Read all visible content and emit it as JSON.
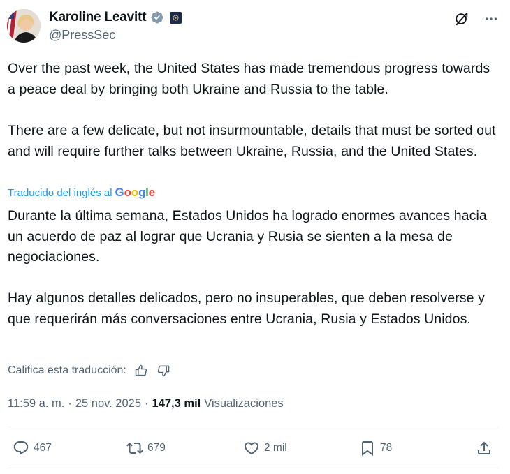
{
  "user": {
    "display_name": "Karoline Leavitt",
    "handle": "@PressSec"
  },
  "tweet": {
    "paragraph_1": "Over the past week, the United States has made tremendous progress towards a peace deal by bringing both Ukraine and Russia to the table.",
    "paragraph_2": "There are a few delicate, but not insurmountable, details that must be sorted out and will require further talks between Ukraine, Russia, and the United States.",
    "translated_label": "Traducido del inglés al",
    "translator": "Google",
    "translation_1": "Durante la última semana, Estados Unidos ha logrado enormes avances hacia un acuerdo de paz al lograr que Ucrania y Rusia se sienten a la mesa de negociaciones.",
    "translation_2": "Hay algunos detalles delicados, pero no insuperables, que deben resolverse y que requerirán más conversaciones entre Ucrania, Rusia y Estados Unidos.",
    "rate_label": "Califica esta traducción:",
    "time": "11:59 a. m.",
    "sep1": "·",
    "date": "25 nov. 2025",
    "sep2": "·",
    "views_count": "147,3 mil",
    "views_label": "Visualizaciones"
  },
  "actions": {
    "replies": "467",
    "reposts": "679",
    "likes": "2 mil",
    "bookmarks": "78"
  },
  "colors": {
    "text": "#0f1419",
    "muted": "#536471",
    "link": "#1d9bf0",
    "verified": "#829aab"
  },
  "icons": {
    "grok": "grok-icon",
    "more": "more-icon",
    "verified": "verified-badge-icon",
    "reply": "reply-icon",
    "repost": "repost-icon",
    "like": "heart-icon",
    "bookmark": "bookmark-icon",
    "share": "share-icon"
  }
}
